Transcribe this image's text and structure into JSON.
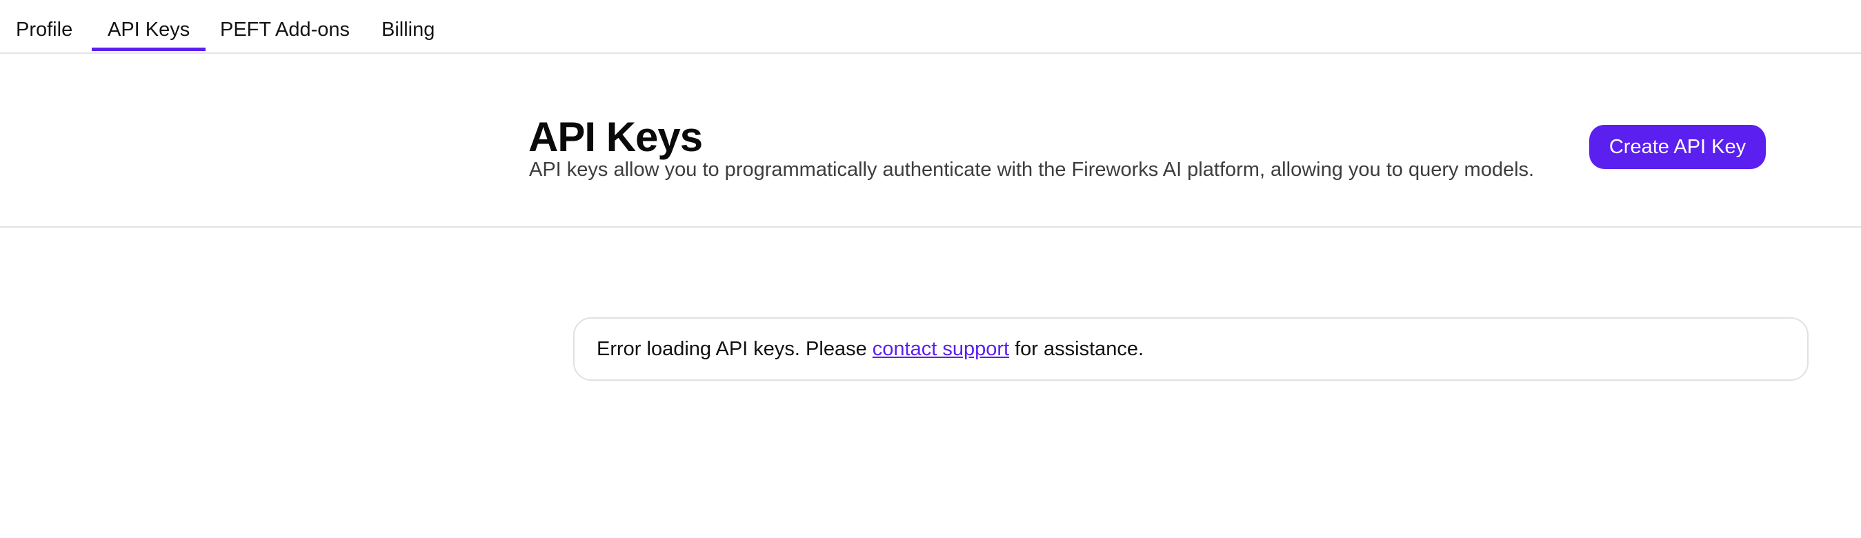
{
  "tabs": [
    {
      "label": "Profile",
      "active": false
    },
    {
      "label": "API Keys",
      "active": true
    },
    {
      "label": "PEFT Add-ons",
      "active": false
    },
    {
      "label": "Billing",
      "active": false
    }
  ],
  "header": {
    "title": "API Keys",
    "description": "API keys allow you to programmatically authenticate with the Fireworks AI platform, allowing you to query models.",
    "create_button_label": "Create API Key"
  },
  "error": {
    "prefix": "Error loading API keys. Please ",
    "link_text": "contact support",
    "suffix": " for assistance."
  },
  "colors": {
    "accent": "#5b1ff0",
    "divider": "#e3e3e6"
  }
}
